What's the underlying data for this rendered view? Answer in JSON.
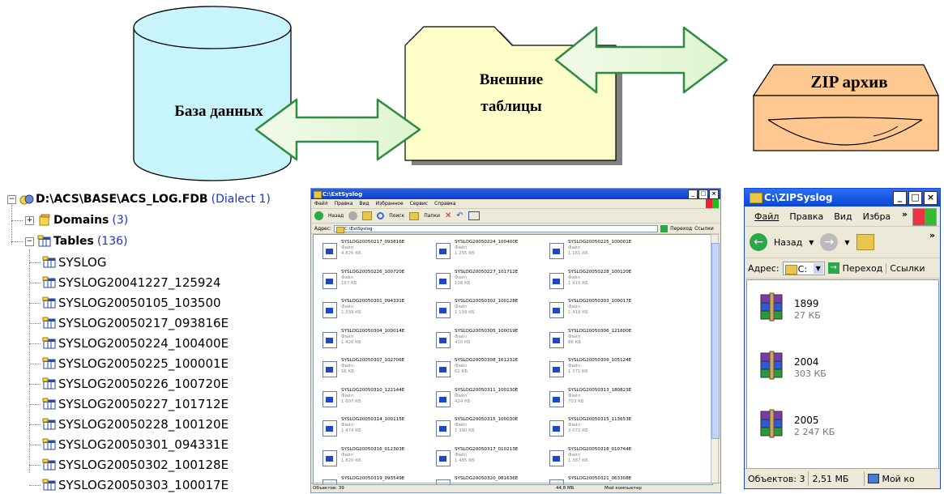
{
  "diagram": {
    "db_label": "База данных",
    "ext_label_1": "Внешние",
    "ext_label_2": "таблицы",
    "zip_label": "ZIP архив"
  },
  "tree": {
    "root_path": "D:\\ACS\\BASE\\ACS_LOG.FDB",
    "root_dialect": "(Dialect 1)",
    "domains_label": "Domains",
    "domains_count": "(3)",
    "tables_label": "Tables",
    "tables_count": "(136)",
    "tables": [
      "SYSLOG",
      "SYSLOG20041227_125924",
      "SYSLOG20050105_103500",
      "SYSLOG20050217_093816E",
      "SYSLOG20050224_100400E",
      "SYSLOG20050225_100001E",
      "SYSLOG20050226_100720E",
      "SYSLOG20050227_101712E",
      "SYSLOG20050228_100120E",
      "SYSLOG20050301_094331E",
      "SYSLOG20050302_100128E",
      "SYSLOG20050303_100017E"
    ]
  },
  "explorer": {
    "title": "C:\\ExtSyslog",
    "menu": [
      "Файл",
      "Правка",
      "Вид",
      "Избранное",
      "Сервис",
      "Справка"
    ],
    "back_label": "Назад",
    "search_label": "Поиск",
    "folders_label": "Папки",
    "address_label": "Адрес:",
    "address_value": "C:\\ExtSyslog",
    "go_label": "Переход",
    "links_label": "Ссылки",
    "status_objects": "Объектов: 39",
    "status_size": "44,8 МБ",
    "status_location": "Мой компьютер",
    "files": [
      {
        "name": "SYSLOG20050217_093816E",
        "type": "Файл",
        "size": "4 826 КБ"
      },
      {
        "name": "SYSLOG20050224_100400E",
        "type": "Файл",
        "size": "1 255 КБ"
      },
      {
        "name": "SYSLOG20050225_100001E",
        "type": "Файл",
        "size": "1 161 КБ"
      },
      {
        "name": "SYSLOG20050226_100720E",
        "type": "Файл",
        "size": "167 КБ"
      },
      {
        "name": "SYSLOG20050227_101712E",
        "type": "Файл",
        "size": "108 КБ"
      },
      {
        "name": "SYSLOG20050228_100120E",
        "type": "Файл",
        "size": "1 415 КБ"
      },
      {
        "name": "SYSLOG20050301_094331E",
        "type": "Файл",
        "size": "1 339 КБ"
      },
      {
        "name": "SYSLOG20050302_100128E",
        "type": "Файл",
        "size": "1 119 КБ"
      },
      {
        "name": "SYSLOG20050303_100017E",
        "type": "Файл",
        "size": "1 419 КБ"
      },
      {
        "name": "SYSLOG20050304_100014E",
        "type": "Файл",
        "size": "1 426 КБ"
      },
      {
        "name": "SYSLOG20050305_100019E",
        "type": "Файл",
        "size": "410 КБ"
      },
      {
        "name": "SYSLOG20050306_121600E",
        "type": "Файл",
        "size": "86 КБ"
      },
      {
        "name": "SYSLOG20050307_102706E",
        "type": "Файл",
        "size": "56 КБ"
      },
      {
        "name": "SYSLOG20050308_161232E",
        "type": "Файл",
        "size": "62 КБ"
      },
      {
        "name": "SYSLOG20050309_105124E",
        "type": "Файл",
        "size": "1 371 КБ"
      },
      {
        "name": "SYSLOG20050310_122144E",
        "type": "Файл",
        "size": "1 607 КБ"
      },
      {
        "name": "SYSLOG20050311_100130E",
        "type": "Файл",
        "size": "424 КБ"
      },
      {
        "name": "SYSLOG20050313_180823E",
        "type": "Файл",
        "size": "703 КБ"
      },
      {
        "name": "SYSLOG20050314_100115E",
        "type": "Файл",
        "size": "1 474 КБ"
      },
      {
        "name": "SYSLOG20050315_100030E",
        "type": "Файл",
        "size": "1 390 КБ"
      },
      {
        "name": "SYSLOG20050315_113653E",
        "type": "Файл",
        "size": "3 072 КБ"
      },
      {
        "name": "SYSLOG20050316_012303E",
        "type": "Файл",
        "size": "1 820 КБ"
      },
      {
        "name": "SYSLOG20050317_010213E",
        "type": "Файл",
        "size": "1 485 КБ"
      },
      {
        "name": "SYSLOG20050318_010744E",
        "type": "Файл",
        "size": "1 387 КБ"
      },
      {
        "name": "SYSLOG20050319_093549E",
        "type": "",
        "size": ""
      },
      {
        "name": "SYSLOG20050320_081636E",
        "type": "",
        "size": ""
      },
      {
        "name": "SYSLOG20050321_063308E",
        "type": "",
        "size": ""
      }
    ]
  },
  "zip_window": {
    "title": "C:\\ZIPSyslog",
    "menu": [
      "Файл",
      "Правка",
      "Вид",
      "Избра"
    ],
    "back_label": "Назад",
    "address_label": "Адрес:",
    "address_value": "C:",
    "go_label": "Переход",
    "links_label": "Ссылки",
    "items": [
      {
        "name": "1899",
        "size": "27 КБ"
      },
      {
        "name": "2004",
        "size": "303 КБ"
      },
      {
        "name": "2005",
        "size": "2 247 КБ"
      }
    ],
    "status_objects": "Объектов: 3",
    "status_size": "2,51 МБ",
    "status_location": "Мой ко"
  },
  "colors": {
    "cylinder_fill": "#c8f4fc",
    "folder_fill": "#fefec8",
    "zip_fill": "#ffc890",
    "arrow_stroke": "#2e8b44",
    "count_blue": "#1a33c8"
  }
}
